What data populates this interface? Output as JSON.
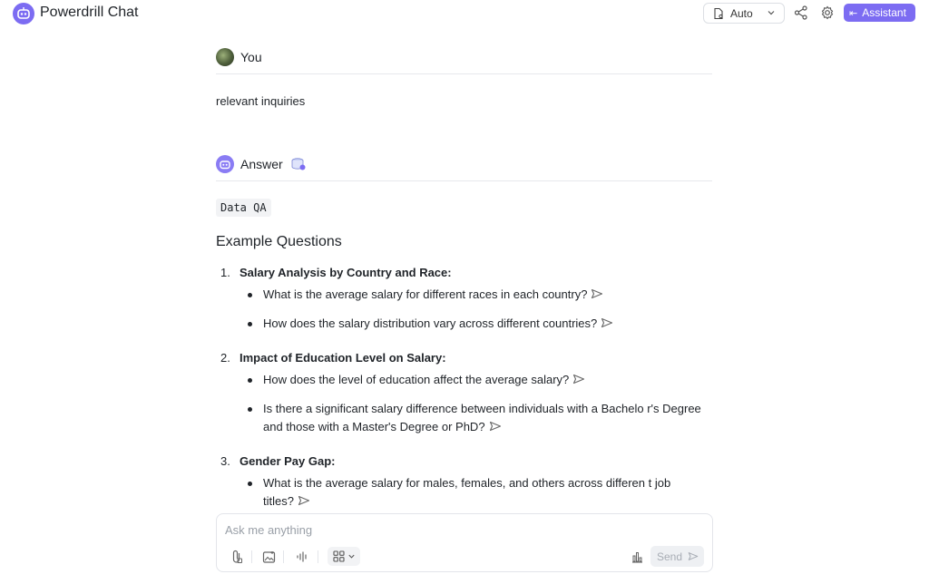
{
  "header": {
    "app_title": "Powerdrill Chat",
    "mode": "Auto",
    "assistant_label": "Assistant",
    "accent_color": "#7c6cf2"
  },
  "user_message": {
    "author": "You",
    "text": "relevant inquiries"
  },
  "answer": {
    "author": "Answer",
    "tag": "Data QA",
    "section_title": "Example Questions",
    "items": [
      {
        "number": "1.",
        "title": "Salary Analysis by Country and Race:",
        "questions": [
          "What is the average salary for different races in each country?",
          "How does the salary distribution vary across different countries?"
        ]
      },
      {
        "number": "2.",
        "title": "Impact of Education Level on Salary:",
        "questions": [
          "How does the level of education affect the average salary?",
          "Is there a significant salary difference between individuals with a Bachelo r's Degree and those with a Master's Degree or PhD?"
        ]
      },
      {
        "number": "3.",
        "title": "Gender Pay Gap:",
        "questions": [
          "What is the average salary for males, females, and others across differen t job titles?"
        ]
      }
    ]
  },
  "composer": {
    "placeholder": "Ask me anything",
    "send_label": "Send"
  }
}
